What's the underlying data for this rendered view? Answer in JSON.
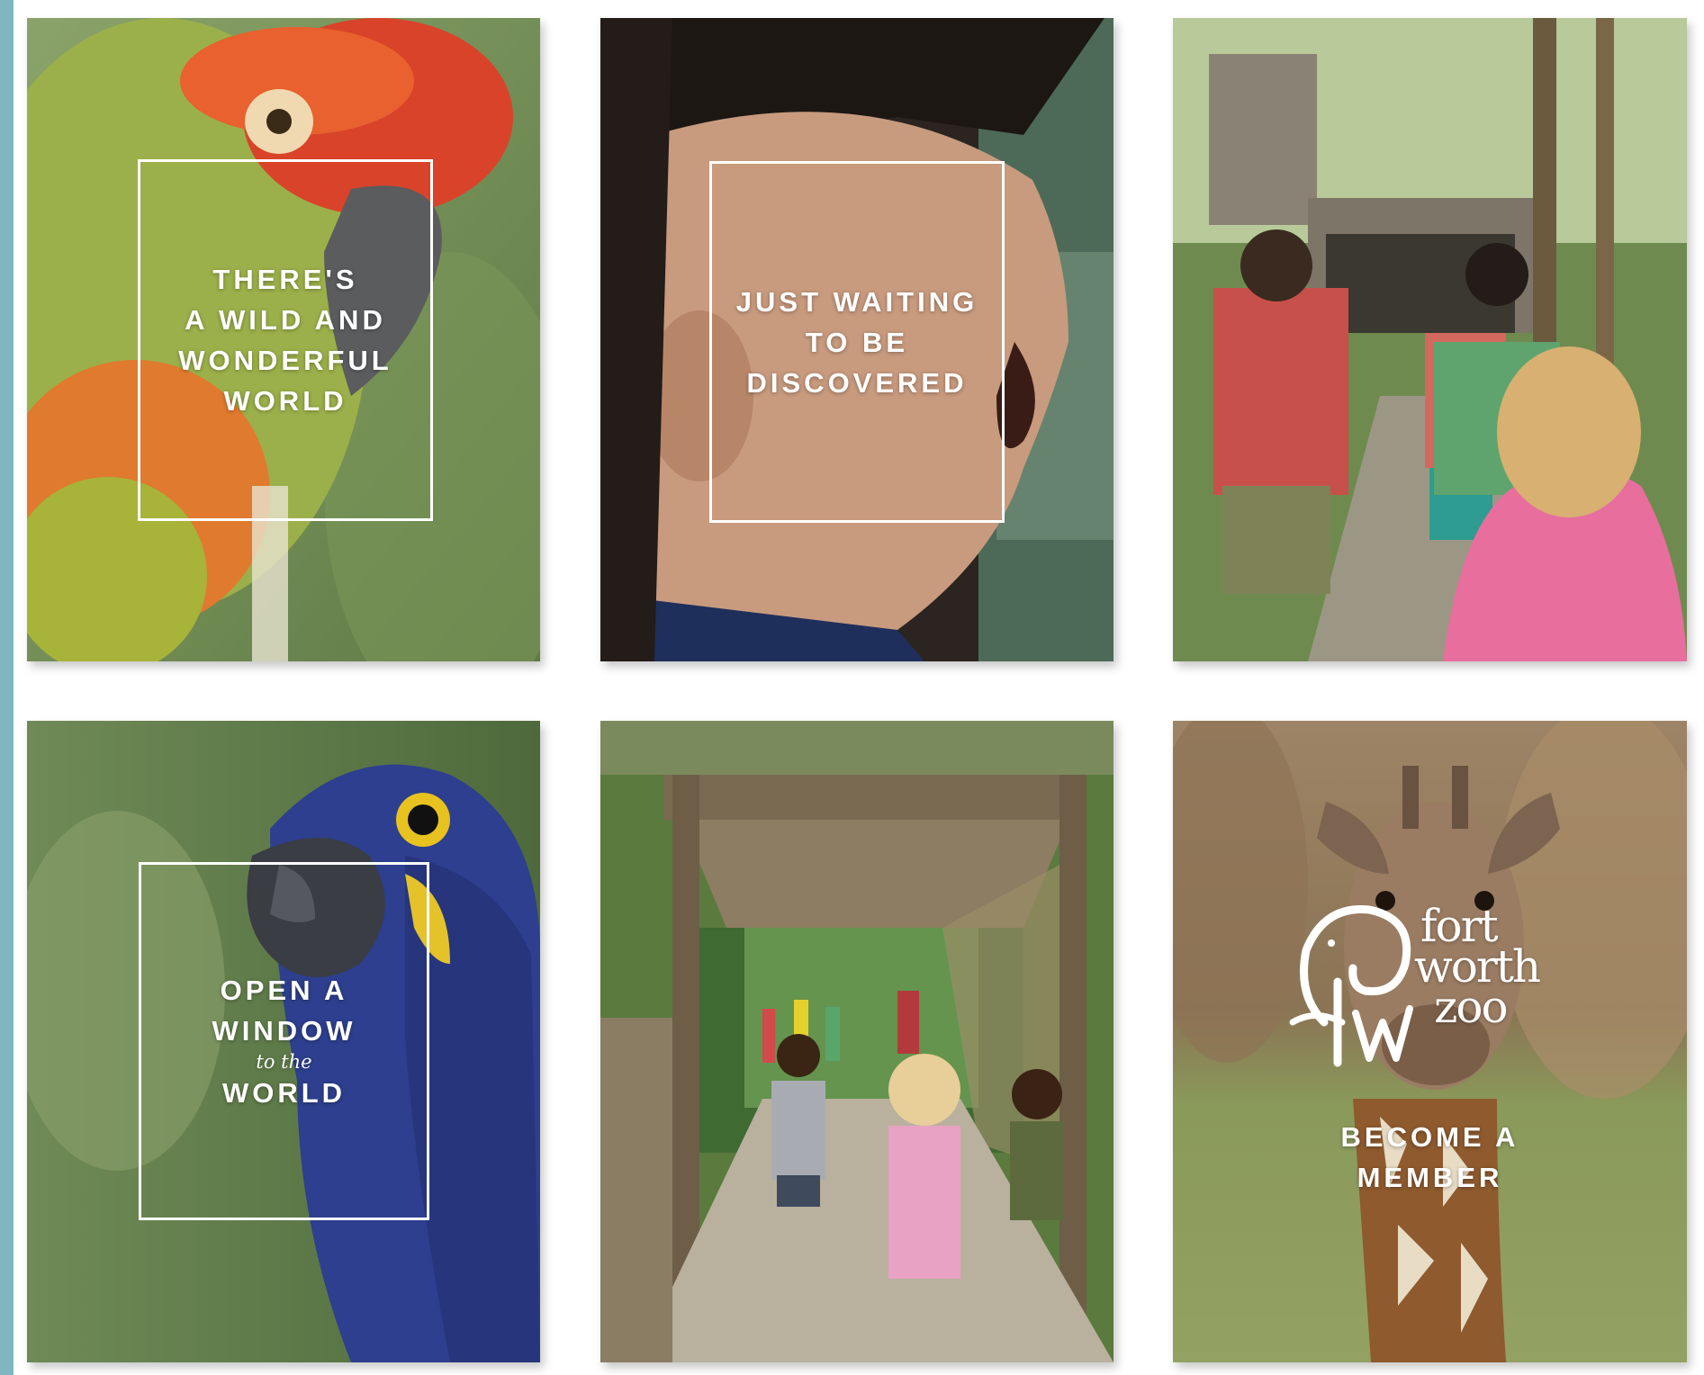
{
  "tiles": [
    {
      "id": "wild-world",
      "caption_lines": [
        "There's",
        "a wild and",
        "wonderful",
        "world"
      ]
    },
    {
      "id": "discovered",
      "caption_lines": [
        "Just waiting",
        "to be",
        "discovered"
      ]
    },
    {
      "id": "kids-trail"
    },
    {
      "id": "open-window",
      "caption": {
        "line1": "Open a",
        "line2": "window",
        "script": "to the",
        "line3": "world"
      }
    },
    {
      "id": "boardwalk"
    },
    {
      "id": "become-member",
      "logo": {
        "words": [
          "fort",
          "worth",
          "zoo"
        ],
        "monogram": "fw"
      },
      "cta_lines": [
        "Become a",
        "member"
      ]
    }
  ],
  "colors": {
    "accent_bar": "#7fb6bf",
    "frame": "#ffffff"
  }
}
